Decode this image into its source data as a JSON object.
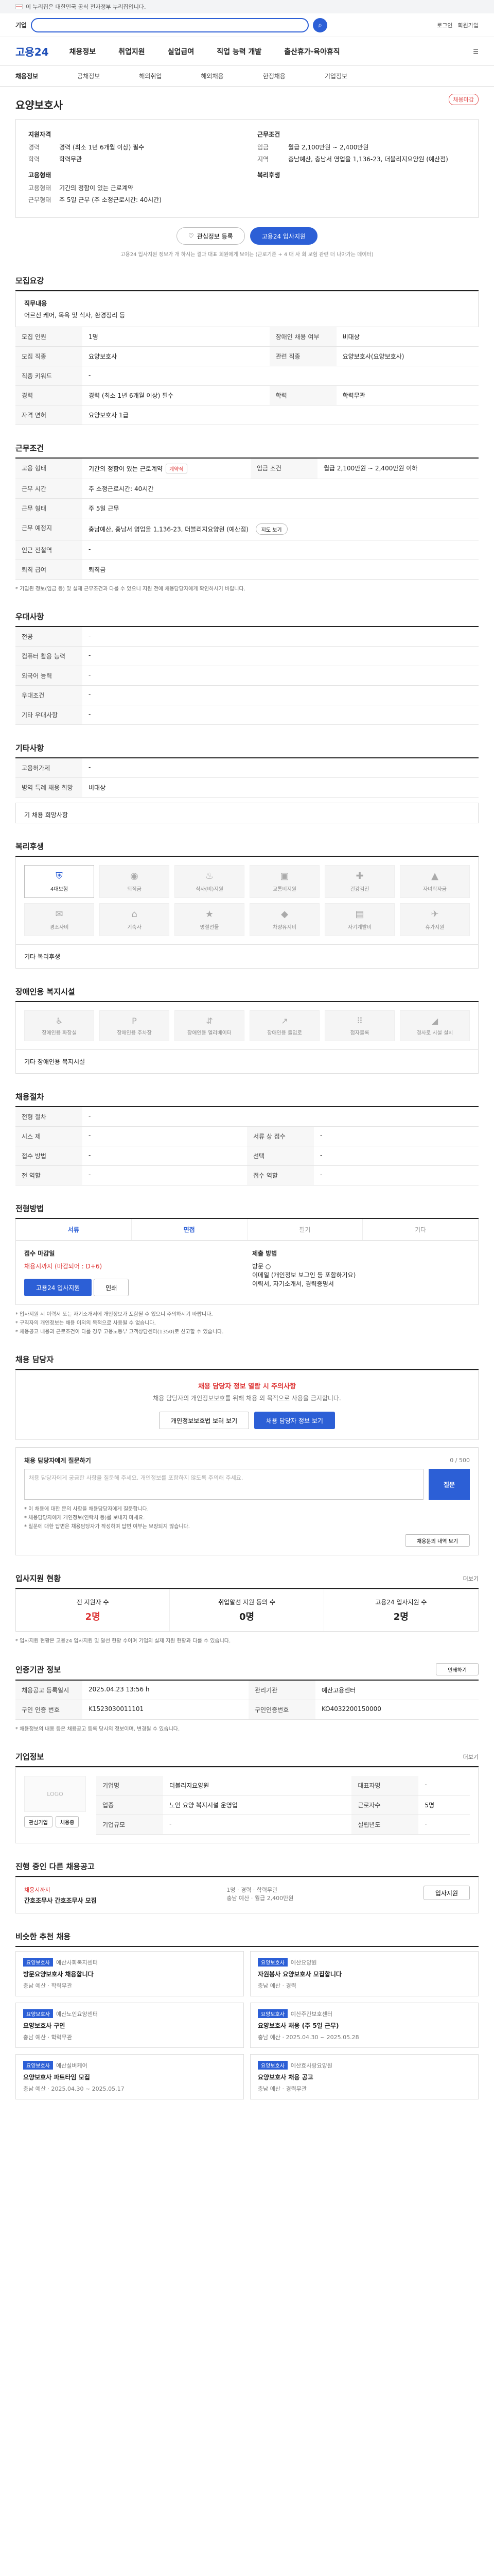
{
  "gov_bar": {
    "text": "이 누리집은 대한민국 공식 전자정부 누리집입니다."
  },
  "search": {
    "title": "기업",
    "placeholder": "",
    "button_icon": "search-icon"
  },
  "util": [
    "로그인",
    "회원가입"
  ],
  "gnb": {
    "logo": "고용24",
    "items": [
      "채용정보",
      "취업지원",
      "실업급여",
      "직업 능력 개발",
      "출산휴가·육아휴직"
    ]
  },
  "snb": [
    "채용정보",
    "공채정보",
    "해외취업",
    "해외채용",
    "한정채용",
    "기업정보"
  ],
  "job": {
    "badge": "채용마감",
    "company": "",
    "title": "요양보호사",
    "summary": {
      "left_title": "지원자격",
      "left_rows": [
        {
          "k": "경력",
          "v": "경력 (최소 1년 6개월 이상) 필수"
        },
        {
          "k": "학력",
          "v": "학력무관"
        }
      ],
      "left_title2": "고용형태",
      "left_rows2": [
        {
          "k": "고용형태",
          "v": "기간의 정함이 있는 근로계약"
        },
        {
          "k": "근무형태",
          "v": "주 5일 근무 (주 소정근로시간: 40시간)"
        }
      ],
      "right_title": "근무조건",
      "right_rows": [
        {
          "k": "임금",
          "v": "월급 2,100만원 ~ 2,400만원"
        },
        {
          "k": "지역",
          "v": "충남예산, 충남서 영업을 1,136-23, 더블리지요양원 (예산점)"
        }
      ],
      "right_title2": "복리후생",
      "right_rows2": []
    },
    "actions": {
      "scrap": "관심정보 등록",
      "apply": "고용24 입사지원"
    },
    "note": "고용24 입사지원 정보가 개 하시는 결과 대표 회원에게 보이는 (근로기준 + 4 대 사 회 보험 관련 더 나아가는 데이터)"
  },
  "recruit": {
    "title": "모집요강",
    "duty_label": "직무내용",
    "duty": "어르신 케어, 목욕 및 식사, 환경정리 등",
    "rows": [
      {
        "k": "모집 인원",
        "v": "1명",
        "k2": "장애인 채용 여부",
        "v2": "비대상"
      },
      {
        "k": "모집 직종",
        "v": "요양보호사",
        "k2": "관련 직종",
        "v2": "요양보호사(요양보호사)"
      },
      {
        "k": "직종 키워드",
        "v": "-",
        "k2": "",
        "v2": ""
      },
      {
        "k": "경력",
        "v": "경력 (최소 1년 6개월 이상) 필수",
        "k2": "학력",
        "v2": "학력무관"
      },
      {
        "k": "자격 면허",
        "v": "요양보호사 1급",
        "k2": "",
        "v2": ""
      }
    ]
  },
  "work": {
    "title": "근무조건",
    "rows": [
      {
        "k": "고용 형태",
        "v": "기간의 정함이 있는 근로계약",
        "chip": "계약직",
        "k2": "임금 조건",
        "v2": "월급 2,100만원 ~ 2,400만원 이하"
      },
      {
        "k": "근무 시간",
        "v": "주 소정근로시간: 40시간",
        "k2": "",
        "v2": ""
      },
      {
        "k": "근무 형태",
        "v": "주 5일 근무",
        "k2": "",
        "v2": ""
      },
      {
        "k": "근무 예정지",
        "v": "충남예산, 충남서 영업을 1,136-23, 더블리지요양원 (예산점)",
        "k2": "",
        "v2": ""
      },
      {
        "k": "인근 전철역",
        "v": "-",
        "k2": "",
        "v2": ""
      },
      {
        "k": "퇴직 급여",
        "v": "퇴직금",
        "k2": "",
        "v2": ""
      }
    ],
    "map_button": "지도 보기",
    "notice": "* 기입된 정보(임금 등) 및 실제 근무조건과 다를 수 있으니 지원 전에 채용담당자에게 확인하시기 바랍니다."
  },
  "preference": {
    "title": "우대사항",
    "rows": [
      {
        "k": "전공",
        "v": "-"
      },
      {
        "k": "컴퓨터 활용 능력",
        "v": "-"
      },
      {
        "k": "외국어 능력",
        "v": "-"
      },
      {
        "k": "우대조건",
        "v": "-"
      },
      {
        "k": "기타 우대사항",
        "v": "-"
      }
    ]
  },
  "etc": {
    "title": "기타사항",
    "rows": [
      {
        "k": "고용허가제",
        "v": "-"
      },
      {
        "k": "병역 특례 채용 희망",
        "v": "비대상"
      }
    ],
    "extra_label": "기 채용 희망사항"
  },
  "welfare": {
    "title": "복리후생",
    "items": [
      {
        "label": "4대보험",
        "icon": "shield-icon",
        "on": true
      },
      {
        "label": "퇴직금",
        "icon": "coin-icon",
        "on": false
      },
      {
        "label": "식사(비)지원",
        "icon": "food-icon",
        "on": false
      },
      {
        "label": "교통비지원",
        "icon": "bus-icon",
        "on": false
      },
      {
        "label": "건강검진",
        "icon": "health-icon",
        "on": false
      },
      {
        "label": "자녀학자금",
        "icon": "school-icon",
        "on": false
      },
      {
        "label": "경조사비",
        "icon": "gift-icon",
        "on": false
      },
      {
        "label": "기숙사",
        "icon": "house-icon",
        "on": false
      },
      {
        "label": "명절선물",
        "icon": "present-icon",
        "on": false
      },
      {
        "label": "차량유지비",
        "icon": "car-icon",
        "on": false
      },
      {
        "label": "자기계발비",
        "icon": "book-icon",
        "on": false
      },
      {
        "label": "휴가지원",
        "icon": "plane-icon",
        "on": false
      }
    ],
    "etc_label": "기타 복리후생"
  },
  "access": {
    "title": "장애인용 복지시설",
    "items": [
      {
        "label": "장애인용 화장실",
        "icon": "toilet-icon"
      },
      {
        "label": "장애인용 주차장",
        "icon": "parking-icon"
      },
      {
        "label": "장애인용 엘리베이터",
        "icon": "elevator-icon"
      },
      {
        "label": "장애인용 출입로",
        "icon": "ramp-icon"
      },
      {
        "label": "점자블록",
        "icon": "braille-icon"
      },
      {
        "label": "경사로 시설 설치",
        "icon": "slope-icon"
      }
    ],
    "etc_label": "기타 장애인용 복지시설"
  },
  "process": {
    "title": "채용절차",
    "rows": [
      {
        "k": "전형 절차",
        "v": "-",
        "k2": "",
        "v2": ""
      },
      {
        "k": "시스 제",
        "v": "-",
        "k2": "서류 상 접수",
        "v2": "-"
      },
      {
        "k": "접수 방법",
        "v": "-",
        "k2": "선택",
        "v2": "-"
      },
      {
        "k": "전 역할",
        "v": "-",
        "k2": "접수 역할",
        "v2": "-"
      }
    ]
  },
  "apply_method": {
    "title": "전형방법",
    "tabs": [
      "서류",
      "면접",
      "필기",
      "기타"
    ],
    "left_title": "접수 마감일",
    "left_date": "채용시까지 (마감되어 : D+6)",
    "left_apply": "고용24 입사지원",
    "left_print": "인쇄",
    "right_title": "제출 방법",
    "right_lines": [
      "방문 ○",
      "이메일 (개인정보 보그인 등 포함하기요)",
      "이력서, 자기소개서, 경력증명서"
    ],
    "notice": [
      "* 입사지원 시 이력서 또는 자기소개서에 개인정보가 포함될 수 있으니 주의하시기 바랍니다.",
      "* 구직자의 개인정보는 채용 이외의 목적으로 사용될 수 없습니다.",
      "* 채용공고 내용과 근로조건이 다를 경우 고용노동부 고객상담센터(1350)로 신고할 수 있습니다."
    ]
  },
  "manager": {
    "title": "채용 담당자",
    "warn": "채용 담당자 정보 열람 시 주의사항",
    "desc": "채용 담당자의 개인정보보호를 위해 채용 외 목적으로 사용을 금지합니다.",
    "buttons": [
      "개인정보보호법 보러 보기",
      "채용 담당자 정보 보기"
    ],
    "ask_title": "채용 담당자에게 질문하기",
    "ask_count": "0 / 500",
    "ask_placeholder": "채용 담당자에게 궁금한 사항을 질문해 주세요. 개인정보를 포함하지 않도록 주의해 주세요.",
    "ask_button": "질문",
    "ask_notes": [
      "* 이 채용에 대한 문의 사항을 채용담당자에게 질문합니다.",
      "* 채용담당자에게 개인정보(연락처 등)를 보내지 마세요.",
      "* 질문에 대한 답변은 채용담당자가 작성하며 답변 여부는 보장되지 않습니다."
    ],
    "ask_link": "채용문의 내역 보기"
  },
  "stats": {
    "title": "입사지원 현황",
    "more": "더보기",
    "items": [
      {
        "label": "전 지원자 수",
        "value": "2명"
      },
      {
        "label": "취업알선 지원 동의 수",
        "value": "0명"
      },
      {
        "label": "고용24 입사지원 수",
        "value": "2명"
      }
    ],
    "notice": "* 입사지원 현황은 고용24 입사지원 및 알선 현황 수이며 기업의 실제 지원 현황과 다를 수 있습니다."
  },
  "info": {
    "title": "인증기관 정보",
    "print_button": "인쇄하기",
    "rows": [
      {
        "k": "채용공고 등록일시",
        "v": "2025.04.23 13:56 h",
        "k2": "관리기관",
        "v2": "예산고용센터"
      },
      {
        "k": "구인 인증 번호",
        "v": "K1523030011101",
        "k2": "구인인증번호",
        "v2": "KO4032200150000"
      }
    ],
    "notice": "* 채용정보의 내용 등은 채용공고 등록 당시의 정보이며, 변경될 수 있습니다."
  },
  "company_info": {
    "title": "기업정보",
    "more": "더보기",
    "logo": "LOGO",
    "rows": [
      {
        "k": "기업명",
        "v": "더블리지요양원",
        "k2": "대표자명",
        "v2": "-"
      },
      {
        "k": "업종",
        "v": "노인 요양 복지시설 운영업",
        "k2": "근로자수",
        "v2": "5명"
      },
      {
        "k": "기업규모",
        "v": "-",
        "k2": "설립년도",
        "v2": "-"
      }
    ],
    "btns": [
      "관심기업",
      "채용중"
    ]
  },
  "other": {
    "title": "진행 중인 다른 채용공고",
    "tag": "채용시까지",
    "job": "간호조무사 간호조무사 모집",
    "meta": [
      "1명",
      "경력",
      "학력무관",
      "충남 예산",
      "월급 2,400만원"
    ],
    "btn": "입사지원"
  },
  "recommend": {
    "title": "비슷한 추천 채용",
    "cards": [
      {
        "tag": "요양보호사",
        "company": "예산사회복지센터",
        "title": "방문요양보호사 채용합니다",
        "meta": "충남 예산 · 학력무관"
      },
      {
        "tag": "요양보호사",
        "company": "예산요양원",
        "title": "자원봉사 요양보호사 모집합니다",
        "meta": "충남 예산 · 경력"
      },
      {
        "tag": "요양보호사",
        "company": "예산노인요양센터",
        "title": "요양보호사 구인",
        "meta": "충남 예산 · 학력무관"
      },
      {
        "tag": "요양보호사",
        "company": "예산주간보호센터",
        "title": "요양보호사 채용 (주 5일 근무)",
        "meta": "충남 예산 · 2025.04.30 ~ 2025.05.28"
      },
      {
        "tag": "요양보호사",
        "company": "예산실버케어",
        "title": "요양보호사 파트타임 모집",
        "meta": "충남 예산 · 2025.04.30 ~ 2025.05.17"
      },
      {
        "tag": "요양보호사",
        "company": "예산효사랑요양원",
        "title": "요양보호사 채용 공고",
        "meta": "충남 예산 · 경력무관"
      }
    ]
  }
}
